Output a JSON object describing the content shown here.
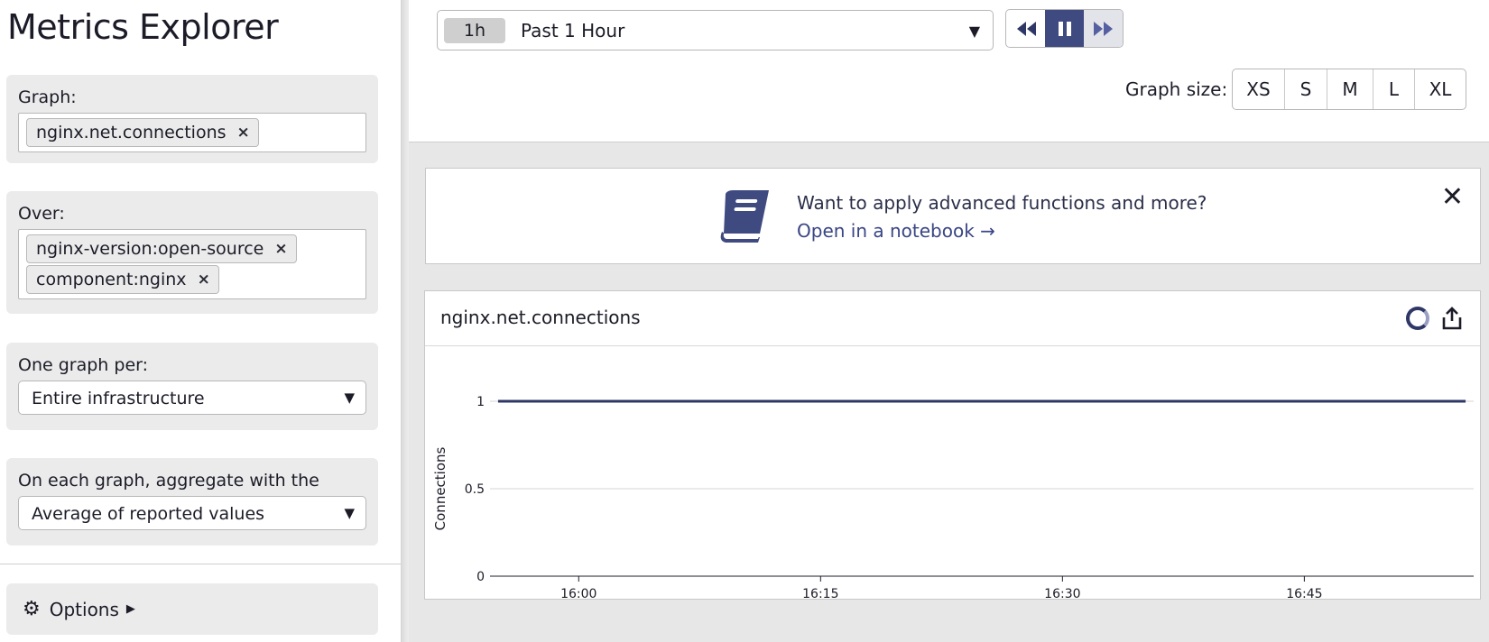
{
  "sidebar": {
    "title": "Metrics Explorer",
    "graph": {
      "label": "Graph:",
      "tags": [
        "nginx.net.connections"
      ]
    },
    "over": {
      "label": "Over:",
      "tags": [
        "nginx-version:open-source",
        "component:nginx"
      ]
    },
    "one_graph_per": {
      "label": "One graph per:",
      "value": "Entire infrastructure"
    },
    "aggregate": {
      "label": "On each graph, aggregate with the",
      "value": "Average of reported values"
    },
    "options_label": "Options",
    "tag_remove_glyph": "×",
    "caret_glyph": "▼"
  },
  "toolbar": {
    "time_chip": "1h",
    "time_label": "Past 1 Hour",
    "graph_size_label": "Graph size:",
    "graph_sizes": [
      "XS",
      "S",
      "M",
      "L",
      "XL"
    ]
  },
  "banner": {
    "title": "Want to apply advanced functions and more?",
    "link": "Open in a notebook →",
    "close_glyph": "✕"
  },
  "graph": {
    "title": "nginx.net.connections"
  },
  "colors": {
    "accent": "#3f4a80",
    "series": "#2e3766"
  },
  "chart_data": {
    "type": "line",
    "ylabel": "Connections",
    "xlabel": "",
    "ylim": [
      0,
      1
    ],
    "yticks": [
      "0",
      "0.5",
      "1"
    ],
    "x_tick_labels": [
      "16:00",
      "16:15",
      "16:30",
      "16:45"
    ],
    "x_range_minutes": [
      -5.5,
      55.5
    ],
    "x_tick_minutes": [
      0,
      15,
      30,
      45
    ],
    "series": [
      {
        "x_minutes": [
          -5,
          55
        ],
        "values": [
          1,
          1
        ]
      }
    ],
    "grid": true
  }
}
